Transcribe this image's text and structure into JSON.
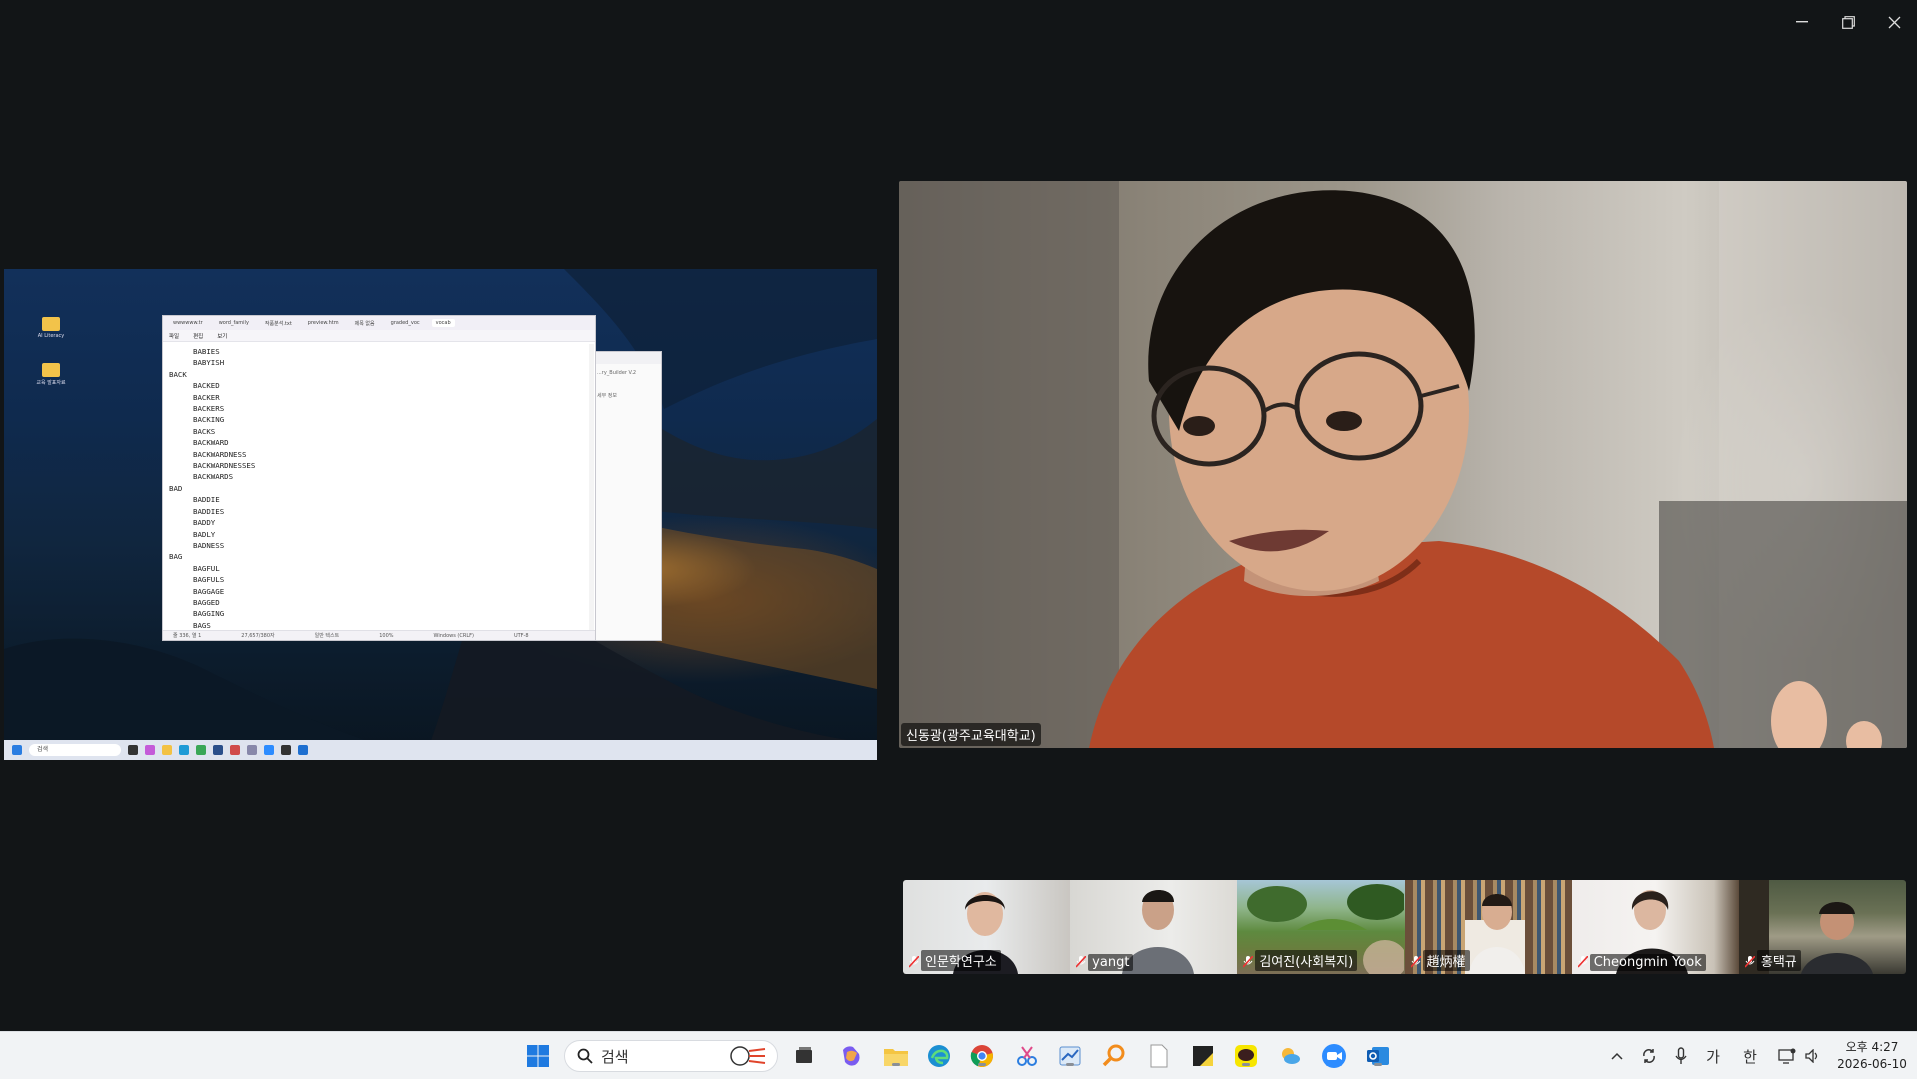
{
  "window_controls": {
    "minimize": "minimize-icon",
    "restore": "restore-icon",
    "close": "close-icon"
  },
  "shared_screen": {
    "desktop_icons": [
      {
        "label": "AI Literacy"
      },
      {
        "label": "교육 발표자료"
      }
    ],
    "notepad": {
      "tabs": [
        "wwwwww.tr",
        "word_family",
        "작품분석.txt",
        "preview.htm",
        "제목 없음",
        "graded_voc",
        "vocab"
      ],
      "menu": [
        "파일",
        "편집",
        "보기"
      ],
      "lines": [
        {
          "level": 1,
          "text": "BABIES"
        },
        {
          "level": 1,
          "text": "BABYISH"
        },
        {
          "level": 0,
          "text": "BACK"
        },
        {
          "level": 1,
          "text": "BACKED"
        },
        {
          "level": 1,
          "text": "BACKER"
        },
        {
          "level": 1,
          "text": "BACKERS"
        },
        {
          "level": 1,
          "text": "BACKING"
        },
        {
          "level": 1,
          "text": "BACKS"
        },
        {
          "level": 1,
          "text": "BACKWARD"
        },
        {
          "level": 1,
          "text": "BACKWARDNESS"
        },
        {
          "level": 1,
          "text": "BACKWARDNESSES"
        },
        {
          "level": 1,
          "text": "BACKWARDS"
        },
        {
          "level": 0,
          "text": "BAD"
        },
        {
          "level": 1,
          "text": "BADDIE"
        },
        {
          "level": 1,
          "text": "BADDIES"
        },
        {
          "level": 1,
          "text": "BADDY"
        },
        {
          "level": 1,
          "text": "BADLY"
        },
        {
          "level": 1,
          "text": "BADNESS"
        },
        {
          "level": 0,
          "text": "BAG"
        },
        {
          "level": 1,
          "text": "BAGFUL"
        },
        {
          "level": 1,
          "text": "BAGFULS"
        },
        {
          "level": 1,
          "text": "BAGGAGE"
        },
        {
          "level": 1,
          "text": "BAGGED"
        },
        {
          "level": 1,
          "text": "BAGGING"
        },
        {
          "level": 1,
          "text": "BAGS"
        }
      ],
      "status": [
        "줄 336, 열 1",
        "27,657/380자",
        "일반 텍스트",
        "100%",
        "Windows (CRLF)",
        "UTF-8"
      ]
    },
    "second_window": {
      "title": "...ry_Builder V.2",
      "side_label": "세부 정보"
    },
    "mini_taskbar": {
      "search": "검색"
    }
  },
  "speaker": {
    "name": "신동광(광주교육대학교)"
  },
  "participants": [
    {
      "name": "인문학연구소",
      "muted": true
    },
    {
      "name": "yangt",
      "muted": true
    },
    {
      "name": "김여진(사회복지)",
      "muted": true
    },
    {
      "name": "趙炳權",
      "muted": true
    },
    {
      "name": "Cheongmin Yook",
      "muted": true
    },
    {
      "name": "홍택규",
      "muted": true
    }
  ],
  "taskbar": {
    "search_placeholder": "검색",
    "apps": [
      "windows-start",
      "task-view",
      "copilot",
      "file-explorer",
      "edge",
      "chrome",
      "snipping-tool",
      "browser-app",
      "search-app",
      "blank-doc",
      "sticky-notes",
      "kakaotalk",
      "weather-app",
      "zoom",
      "outlook"
    ],
    "tray": {
      "ime_1": "가",
      "ime_2": "한"
    },
    "clock": {
      "time": "오후 4:27",
      "date": "2026-06-10"
    }
  },
  "colors": {
    "background": "#121517",
    "taskbar": "#f1f3f5",
    "accent": "#2d8cff"
  }
}
